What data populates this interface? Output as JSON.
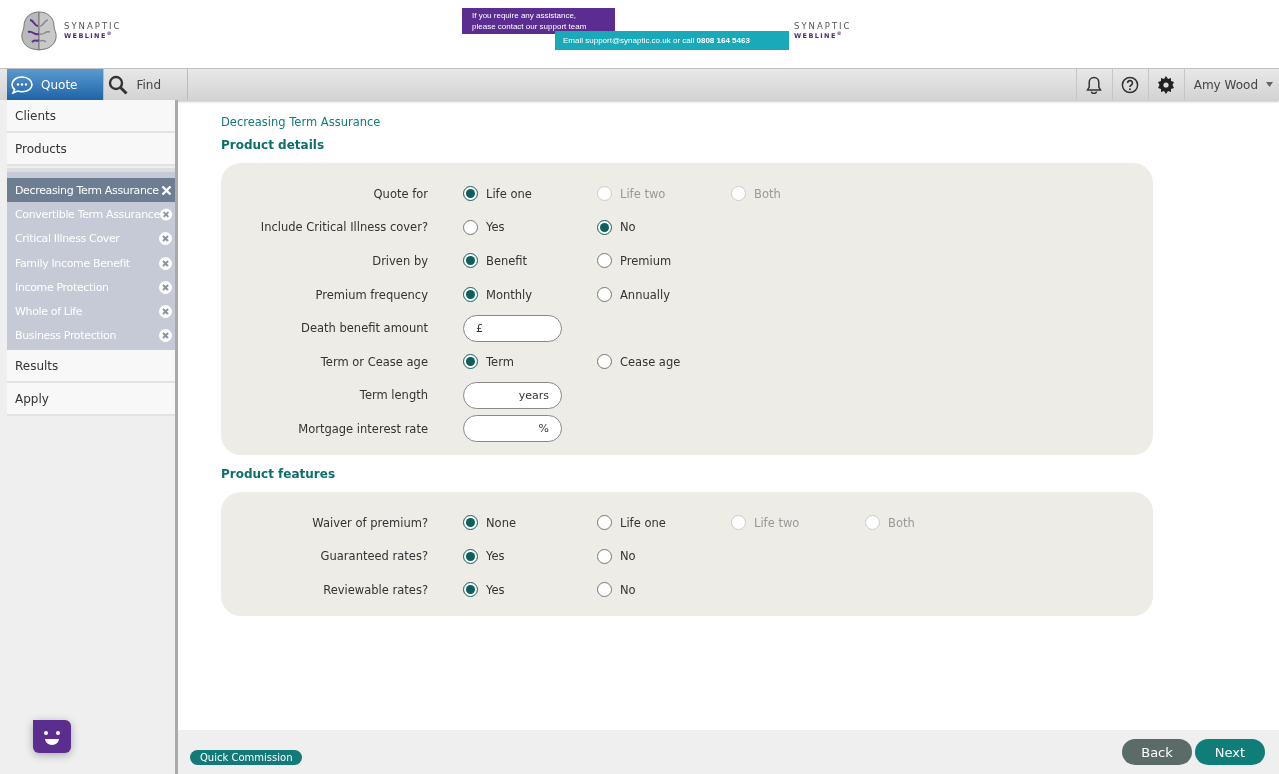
{
  "header": {
    "logo": {
      "line1": "SYNAPTIC",
      "line2": "WEBLINE$^{®}$"
    },
    "support": {
      "line1": "If you require any assistance,",
      "line2": "please contact our support team",
      "contact": "Email support@synaptic.co.uk or call **0808 164 5463**"
    },
    "right_logo": {
      "line1": "SYNAPTIC",
      "line2": "WEBLINE$^{®}$"
    }
  },
  "toolbar": {
    "tabs": [
      {
        "label": "Quote",
        "selected": true
      },
      {
        "label": "Find",
        "selected": false
      }
    ],
    "user": "Amy Wood"
  },
  "sidebar": {
    "items": [
      {
        "label": "Clients",
        "kind": "nav"
      },
      {
        "label": "Products",
        "kind": "nav"
      },
      {
        "kind": "group",
        "children": [
          {
            "label": "Decreasing Term Assurance",
            "selected": true
          },
          {
            "label": "Convertible Term Assurance",
            "selected": false
          },
          {
            "label": "Critical Illness Cover",
            "selected": false
          },
          {
            "label": "Family Income Benefit",
            "selected": false
          },
          {
            "label": "Income Protection",
            "selected": false
          },
          {
            "label": "Whole of Life",
            "selected": false
          },
          {
            "label": "Business Protection",
            "selected": false
          }
        ]
      },
      {
        "label": "Results",
        "kind": "nav"
      },
      {
        "label": "Apply",
        "kind": "nav"
      }
    ]
  },
  "content": {
    "breadcrumb": "Decreasing Term Assurance",
    "sections": [
      {
        "title": "Product details",
        "rows": [
          {
            "kind": "radio",
            "label": "Quote for",
            "options": [
              {
                "label": "Life one",
                "selected": true,
                "disabled": false
              },
              {
                "label": "Life two",
                "selected": false,
                "disabled": true
              },
              {
                "label": "Both",
                "selected": false,
                "disabled": true
              }
            ]
          },
          {
            "kind": "radio",
            "label": "Include Critical Illness cover?",
            "options": [
              {
                "label": "Yes",
                "selected": false,
                "disabled": false
              },
              {
                "label": "No",
                "selected": true,
                "disabled": false
              }
            ]
          },
          {
            "kind": "radio",
            "label": "Driven by",
            "options": [
              {
                "label": "Benefit",
                "selected": true,
                "disabled": false
              },
              {
                "label": "Premium",
                "selected": false,
                "disabled": false
              }
            ]
          },
          {
            "kind": "radio",
            "label": "Premium frequency",
            "options": [
              {
                "label": "Monthly",
                "selected": true,
                "disabled": false
              },
              {
                "label": "Annually",
                "selected": false,
                "disabled": false
              }
            ]
          },
          {
            "kind": "input",
            "label": "Death benefit amount",
            "prefix": "£"
          },
          {
            "kind": "radio",
            "label": "Term or Cease age",
            "options": [
              {
                "label": "Term",
                "selected": true,
                "disabled": false
              },
              {
                "label": "Cease age",
                "selected": false,
                "disabled": false
              }
            ]
          },
          {
            "kind": "input",
            "label": "Term length",
            "suffix": "years"
          },
          {
            "kind": "input",
            "label": "Mortgage interest rate",
            "suffix": "%"
          }
        ]
      },
      {
        "title": "Product features",
        "rows": [
          {
            "kind": "radio",
            "label": "Waiver of premium?",
            "options": [
              {
                "label": "None",
                "selected": true,
                "disabled": false
              },
              {
                "label": "Life one",
                "selected": false,
                "disabled": false
              },
              {
                "label": "Life two",
                "selected": false,
                "disabled": true
              },
              {
                "label": "Both",
                "selected": false,
                "disabled": true
              }
            ]
          },
          {
            "kind": "radio",
            "label": "Guaranteed rates?",
            "options": [
              {
                "label": "Yes",
                "selected": true,
                "disabled": false
              },
              {
                "label": "No",
                "selected": false,
                "disabled": false
              }
            ]
          },
          {
            "kind": "radio",
            "label": "Reviewable rates?",
            "options": [
              {
                "label": "Yes",
                "selected": true,
                "disabled": false
              },
              {
                "label": "No",
                "selected": false,
                "disabled": false
              }
            ]
          }
        ]
      }
    ]
  },
  "footer": {
    "quick_commission": "Quick Commission",
    "buttons": [
      {
        "label": "Back",
        "kind": "secondary"
      },
      {
        "label": "Next",
        "kind": "primary"
      }
    ]
  }
}
